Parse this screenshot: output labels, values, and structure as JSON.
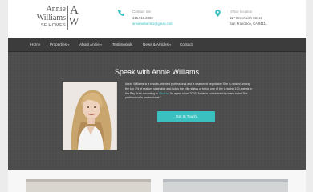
{
  "brand": {
    "line1": "Annie",
    "line2": "Williams",
    "line3": "SF HOMES",
    "monogram_a": "A",
    "monogram_w": "W"
  },
  "contact": {
    "label": "Contact me",
    "phone": "415.919.2863",
    "email": "anniewilliams1@gmail.com",
    "icon": "phone-icon"
  },
  "office": {
    "label": "Office location",
    "address1": "117 Greenwich Street",
    "address2": "San Francisco, CA 94111",
    "icon": "location-pin-icon"
  },
  "nav": {
    "items": [
      {
        "label": "Home",
        "has_caret": false
      },
      {
        "label": "Properties",
        "has_caret": true
      },
      {
        "label": "About Annie",
        "has_caret": true
      },
      {
        "label": "Testimonials",
        "has_caret": false
      },
      {
        "label": "News & Articles",
        "has_caret": true
      },
      {
        "label": "Contact",
        "has_caret": false
      }
    ],
    "caret_glyph": "▾"
  },
  "hero": {
    "title": "Speak with Annie Williams",
    "bio_part1": "Annie Williams is a results-oriented professional and a seasoned negotiator. She is ranked among the top 1% of realtors statewide and holds the elite status of being one of the Leading 100 agents in the Bay Area according to",
    "bio_link": "SanFrn",
    "bio_part2": ". An agent since 2003, Annie is considered by many to be \"the professional's professional.\"",
    "cta_label": "Get In Touch"
  },
  "colors": {
    "accent": "#3bbfbf",
    "nav_bg": "#3c3c3c",
    "hero_bg": "#4c4c4c"
  }
}
